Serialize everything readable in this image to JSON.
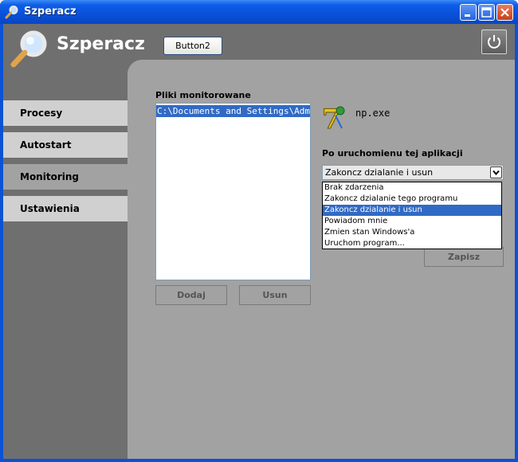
{
  "window": {
    "title": "Szperacz"
  },
  "header": {
    "app_title": "Szperacz",
    "button2_label": "Button2"
  },
  "nav": {
    "items": [
      {
        "label": "Procesy",
        "active": false
      },
      {
        "label": "Autostart",
        "active": false
      },
      {
        "label": "Monitoring",
        "active": true
      },
      {
        "label": "Ustawienia",
        "active": false
      }
    ]
  },
  "monitoring": {
    "files_label": "Pliki monitorowane",
    "files": [
      "C:\\Documents and Settings\\Administrator"
    ],
    "add_label": "Dodaj",
    "remove_label": "Usun",
    "app_name": "np.exe",
    "after_run_label": "Po uruchomienu tej aplikacji",
    "action_selected": "Zakoncz dzialanie i usun",
    "action_options": [
      "Brak zdarzenia",
      "Zakoncz dzialanie tego programu",
      "Zakoncz dzialanie i usun",
      "Powiadom mnie",
      "Zmien stan Windows'a",
      "Uruchom program..."
    ],
    "action_selected_index": 2,
    "save_label": "Zapisz"
  },
  "colors": {
    "title_bar": "#0a50d8",
    "selection": "#316ac5",
    "panel": "#a2a2a2",
    "background": "#6f6f6f"
  }
}
